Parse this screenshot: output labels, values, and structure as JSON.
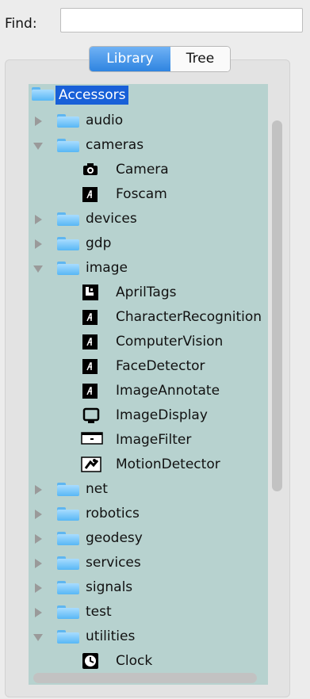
{
  "find": {
    "label": "Find:",
    "value": ""
  },
  "tabs": {
    "library": "Library",
    "tree": "Tree",
    "active": "Library"
  },
  "tree": {
    "root": "Accessors",
    "rows": [
      {
        "label": "audio",
        "type": "folder",
        "state": "collapsed",
        "level": 1
      },
      {
        "label": "cameras",
        "type": "folder",
        "state": "expanded",
        "level": 1
      },
      {
        "label": "Camera",
        "type": "item",
        "icon": "camera-icon",
        "level": 2
      },
      {
        "label": "Foscam",
        "type": "item",
        "icon": "accessor-icon",
        "level": 2
      },
      {
        "label": "devices",
        "type": "folder",
        "state": "collapsed",
        "level": 1
      },
      {
        "label": "gdp",
        "type": "folder",
        "state": "collapsed",
        "level": 1
      },
      {
        "label": "image",
        "type": "folder",
        "state": "expanded",
        "level": 1
      },
      {
        "label": "AprilTags",
        "type": "item",
        "icon": "apriltag-icon",
        "level": 2
      },
      {
        "label": "CharacterRecognition",
        "type": "item",
        "icon": "accessor-icon",
        "level": 2
      },
      {
        "label": "ComputerVision",
        "type": "item",
        "icon": "accessor-icon",
        "level": 2
      },
      {
        "label": "FaceDetector",
        "type": "item",
        "icon": "accessor-icon",
        "level": 2
      },
      {
        "label": "ImageAnnotate",
        "type": "item",
        "icon": "accessor-icon",
        "level": 2
      },
      {
        "label": "ImageDisplay",
        "type": "item",
        "icon": "monitor-icon",
        "level": 2
      },
      {
        "label": "ImageFilter",
        "type": "item",
        "icon": "filter-icon",
        "level": 2
      },
      {
        "label": "MotionDetector",
        "type": "item",
        "icon": "motion-icon",
        "level": 2
      },
      {
        "label": "net",
        "type": "folder",
        "state": "collapsed",
        "level": 1
      },
      {
        "label": "robotics",
        "type": "folder",
        "state": "collapsed",
        "level": 1
      },
      {
        "label": "geodesy",
        "type": "folder",
        "state": "collapsed",
        "level": 1
      },
      {
        "label": "services",
        "type": "folder",
        "state": "collapsed",
        "level": 1
      },
      {
        "label": "signals",
        "type": "folder",
        "state": "collapsed",
        "level": 1
      },
      {
        "label": "test",
        "type": "folder",
        "state": "collapsed",
        "level": 1
      },
      {
        "label": "utilities",
        "type": "folder",
        "state": "expanded",
        "level": 1
      },
      {
        "label": "Clock",
        "type": "item",
        "icon": "clock-icon",
        "level": 2
      }
    ]
  },
  "colors": {
    "selection": "#1860d8",
    "tree_bg": "#b7d2cf",
    "tab_active": "#2f84e0"
  }
}
